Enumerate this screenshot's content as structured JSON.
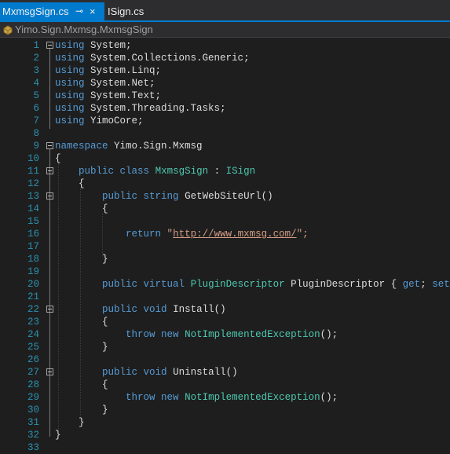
{
  "tabs": [
    {
      "label": "MxmsgSign.cs",
      "pin_icon": "pin-icon",
      "close_icon": "close-icon",
      "close": "×",
      "pin": "⊸"
    },
    {
      "label": "ISign.cs"
    }
  ],
  "nav": {
    "path": "Yimo.Sign.Mxmsg.MxmsgSign"
  },
  "lines": [
    {
      "n": "1",
      "fold": true
    },
    {
      "n": "2"
    },
    {
      "n": "3"
    },
    {
      "n": "4"
    },
    {
      "n": "5"
    },
    {
      "n": "6"
    },
    {
      "n": "7"
    },
    {
      "n": "8"
    },
    {
      "n": "9",
      "fold": true
    },
    {
      "n": "10"
    },
    {
      "n": "11",
      "fold": true
    },
    {
      "n": "12"
    },
    {
      "n": "13",
      "fold": true
    },
    {
      "n": "14"
    },
    {
      "n": "15"
    },
    {
      "n": "16"
    },
    {
      "n": "17"
    },
    {
      "n": "18"
    },
    {
      "n": "19"
    },
    {
      "n": "20"
    },
    {
      "n": "21"
    },
    {
      "n": "22",
      "fold": true
    },
    {
      "n": "23"
    },
    {
      "n": "24"
    },
    {
      "n": "25"
    },
    {
      "n": "26"
    },
    {
      "n": "27",
      "fold": true
    },
    {
      "n": "28"
    },
    {
      "n": "29"
    },
    {
      "n": "30"
    },
    {
      "n": "31"
    },
    {
      "n": "32"
    },
    {
      "n": "33"
    }
  ],
  "code": {
    "l1": [
      "using",
      "System;"
    ],
    "l2": [
      "using",
      "System.Collections.Generic;"
    ],
    "l3": [
      "using",
      "System.Linq;"
    ],
    "l4": [
      "using",
      "System.Net;"
    ],
    "l5": [
      "using",
      "System.Text;"
    ],
    "l6": [
      "using",
      "System.Threading.Tasks;"
    ],
    "l7": [
      "using",
      "YimoCore;"
    ],
    "l9": [
      "namespace",
      "Yimo.Sign.Mxmsg"
    ],
    "l10": "{",
    "l11": [
      "public",
      "class",
      "MxmsgSign",
      ":",
      "ISign"
    ],
    "l12": "{",
    "l13": [
      "public",
      "string",
      "GetWebSiteUrl()"
    ],
    "l14": "{",
    "l16": [
      "return",
      "\"",
      "http://www.mxmsg.com/",
      "\";"
    ],
    "l18": "}",
    "l20": [
      "public",
      "virtual",
      "PluginDescriptor",
      "PluginDescriptor {",
      "get",
      ";",
      "set",
      "; }"
    ],
    "l22": [
      "public",
      "void",
      "Install()"
    ],
    "l23": "{",
    "l24": [
      "throw",
      "new",
      "NotImplementedException",
      "();"
    ],
    "l25": "}",
    "l27": [
      "public",
      "void",
      "Uninstall()"
    ],
    "l28": "{",
    "l29": [
      "throw",
      "new",
      "NotImplementedException",
      "();"
    ],
    "l30": "}",
    "l31": "}",
    "l32": "}"
  },
  "colors": {
    "keyword": "#569cd6",
    "type": "#4ec9b0",
    "string": "#d69d85",
    "line_number": "#2b91af",
    "accent": "#007acc"
  }
}
